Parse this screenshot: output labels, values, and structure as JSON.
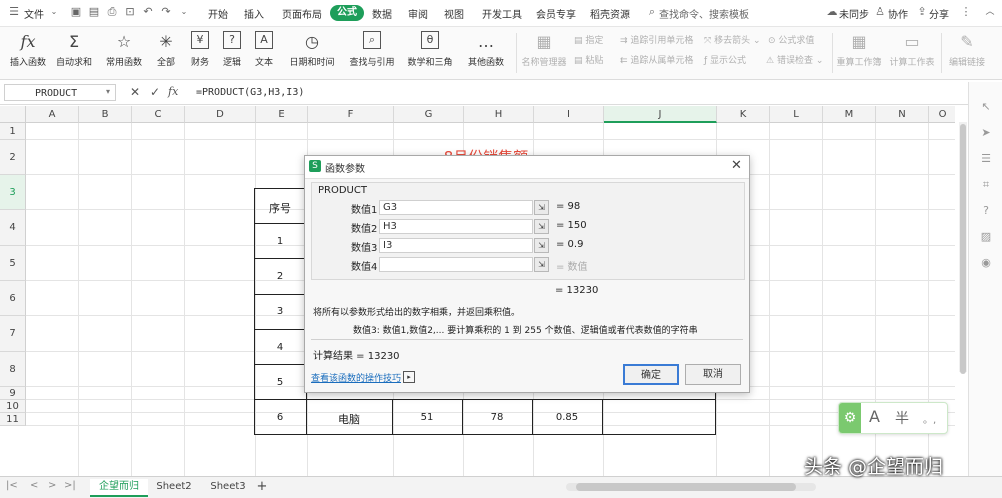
{
  "menubar": {
    "file": "文件",
    "tabs": [
      "开始",
      "插入",
      "页面布局",
      "公式",
      "数据",
      "审阅",
      "视图",
      "开发工具",
      "会员专享",
      "稻壳资源"
    ],
    "active_tab": "公式",
    "search": "查找命令、搜索模板",
    "sync": "未同步",
    "collab": "协作",
    "share": "分享"
  },
  "ribbon": {
    "main": [
      {
        "icon": "fx",
        "label": "插入函数"
      },
      {
        "icon": "Σ",
        "label": "自动求和"
      },
      {
        "icon": "☆",
        "label": "常用函数"
      },
      {
        "icon": "✳",
        "label": "全部"
      },
      {
        "icon": "¥",
        "label": "财务"
      },
      {
        "icon": "?",
        "label": "逻辑"
      },
      {
        "icon": "A",
        "label": "文本"
      },
      {
        "icon": "◷",
        "label": "日期和时间"
      },
      {
        "icon": "⌕",
        "label": "查找与引用"
      },
      {
        "icon": "θ",
        "label": "数学和三角"
      },
      {
        "icon": "…",
        "label": "其他函数"
      }
    ],
    "name_manager": "名称管理器",
    "specify": "指定",
    "paste": "粘贴",
    "trace_precedents": "追踪引用单元格",
    "trace_dependents": "追踪从属单元格",
    "remove_arrows": "移去箭头",
    "show_formulas": "显示公式",
    "formula_eval": "公式求值",
    "error_check": "错误检查",
    "recalc_workbook": "重算工作簿",
    "calc_sheet": "计算工作表",
    "edit_links": "编辑链接"
  },
  "formula_bar": {
    "name_box": "PRODUCT",
    "fx": "fx",
    "formula": "=PRODUCT(G3,H3,I3)"
  },
  "columns": [
    "A",
    "B",
    "C",
    "D",
    "E",
    "F",
    "G",
    "H",
    "I",
    "J",
    "K",
    "L",
    "M",
    "N",
    "O"
  ],
  "rows": [
    "1",
    "2",
    "3",
    "4",
    "5",
    "6",
    "7",
    "8",
    "9",
    "10",
    "11"
  ],
  "sheet": {
    "title": "8月份销售额",
    "header_seq": "序号",
    "seq": [
      "1",
      "2",
      "3",
      "4",
      "5",
      "6"
    ],
    "row8": {
      "product": "电脑",
      "g": "51",
      "h": "78",
      "i": "0.85"
    }
  },
  "dialog": {
    "title": "函数参数",
    "func_name": "PRODUCT",
    "args": [
      {
        "label": "数值1",
        "value": "G3",
        "result": "= 98"
      },
      {
        "label": "数值2",
        "value": "H3",
        "result": "= 150"
      },
      {
        "label": "数值3",
        "value": "I3",
        "result": "= 0.9"
      },
      {
        "label": "数值4",
        "value": "",
        "result": "= 数值"
      }
    ],
    "total": "= 13230",
    "description": "将所有以参数形式给出的数字相乘，并返回乘积值。",
    "arg_desc": "数值3:   数值1,数值2,... 要计算乘积的 1 到 255 个数值、逻辑值或者代表数值的字符串",
    "calc_result": "计算结果 = 13230",
    "help_link": "查看该函数的操作技巧",
    "ok": "确定",
    "cancel": "取消"
  },
  "tabs": {
    "items": [
      "企望而归",
      "Sheet2",
      "Sheet3"
    ],
    "active": "企望而归",
    "add": "+"
  },
  "ime": {
    "letter": "A",
    "mode": "半",
    "punct": "。,"
  },
  "watermark": "头条 @企望而归",
  "colors": {
    "accent": "#1e9e5a",
    "title_red": "#e84c3d",
    "link": "#1a6dbd"
  }
}
